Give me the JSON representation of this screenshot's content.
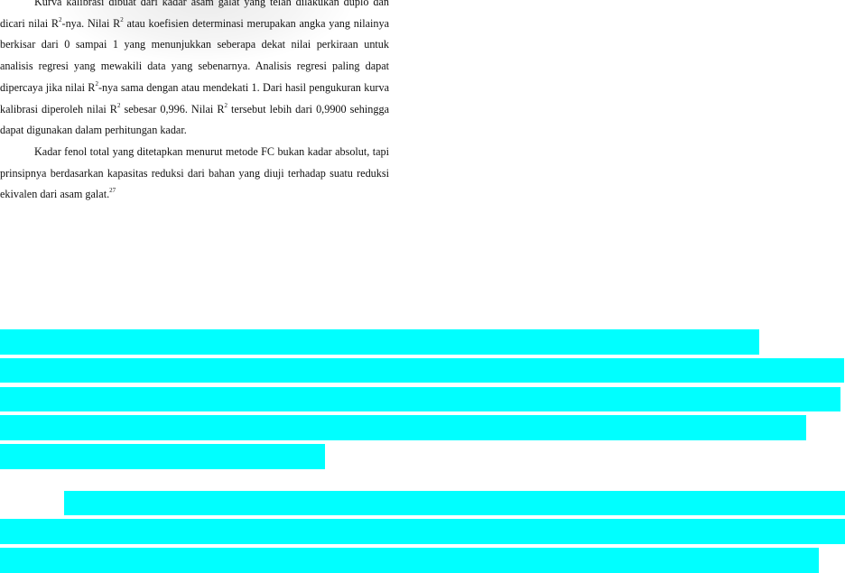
{
  "watermark": {
    "name": "university-seal-watermark"
  },
  "paragraph_1": {
    "part_1": "Kurva kalibrasi dibuat dari kadar asam galat yang telah dilakukan duplo dan dicari nilai R",
    "sup_1": "2",
    "part_2": "-nya. Nilai R",
    "sup_2": "2",
    "part_3": " atau koefisien determinasi merupakan angka yang nilainya berkisar dari 0 sampai 1 yang menunjukkan seberapa dekat nilai perkiraan untuk analisis regresi yang mewakili data yang sebenarnya. Analisis regresi paling dapat dipercaya jika nilai  R",
    "sup_3": "2",
    "part_4": "-nya sama dengan atau mendekati 1. Dari hasil pengukuran kurva kalibrasi diperoleh nilai R",
    "sup_4": "2",
    "part_5": " sebesar 0,996. Nilai R",
    "sup_5": "2",
    "part_6": " tersebut lebih dari 0,9900 sehingga dapat digunakan dalam perhitungan kadar."
  },
  "paragraph_2": {
    "text": "Kadar fenol total yang ditetapkan menurut metode FC bukan kadar absolut, tapi prinsipnya berdasarkan kapasitas reduksi dari bahan yang diuji terhadap suatu reduksi ekivalen dari asam galat.",
    "footnote": "27"
  },
  "redaction_color": "#00ffff"
}
